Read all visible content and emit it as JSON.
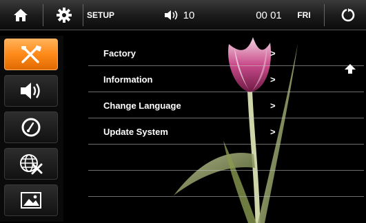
{
  "topbar": {
    "home_icon": "home-icon",
    "settings_icon": "gear-icon",
    "title": "SETUP",
    "volume_icon": "speaker-icon",
    "volume": "10",
    "time": "00 01",
    "day": "FRI",
    "back_icon": "power-back-icon"
  },
  "sidebar": {
    "items": [
      {
        "icon": "tools-icon",
        "active": true
      },
      {
        "icon": "speaker-icon",
        "active": false
      },
      {
        "icon": "dial-icon",
        "active": false
      },
      {
        "icon": "globe-tools-icon",
        "active": false
      },
      {
        "icon": "picture-icon",
        "active": false
      }
    ]
  },
  "menu": {
    "items": [
      {
        "label": "Factory"
      },
      {
        "label": "Information"
      },
      {
        "label": "Change Language"
      },
      {
        "label": "Update System"
      }
    ],
    "arrow": ">"
  },
  "colors": {
    "accent": "#ff8a1a",
    "background": "#000000"
  }
}
